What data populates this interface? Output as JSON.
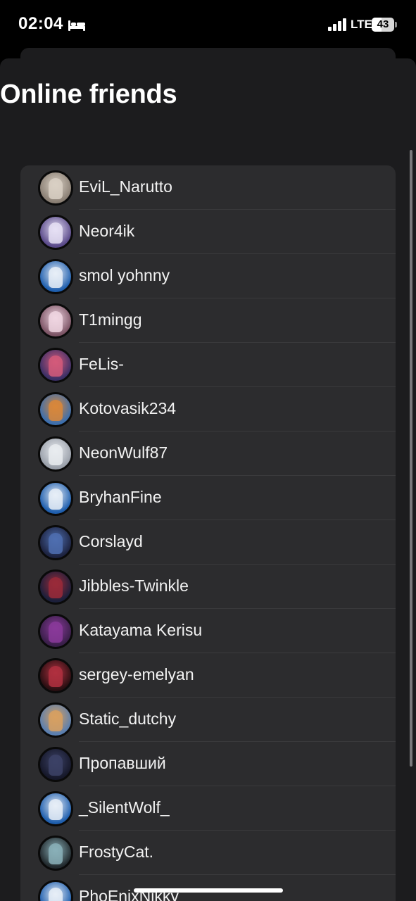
{
  "status_bar": {
    "time": "02:04",
    "network": "LTE",
    "battery_level": "43",
    "icons": [
      "bed-icon",
      "signal-icon",
      "battery-icon"
    ]
  },
  "page": {
    "title": "Online friends"
  },
  "friends": [
    {
      "name": "EviL_Narutto",
      "avatar_color": "#8a7f74",
      "figure_color": "#d9d0c4"
    },
    {
      "name": "Neor4ik",
      "avatar_color": "#5a4a8a",
      "figure_color": "#e6e0f5"
    },
    {
      "name": "smol yohnny",
      "avatar_color": "#1f5fae",
      "figure_color": "#e8eef7"
    },
    {
      "name": "T1mingg",
      "avatar_color": "#7d5566",
      "figure_color": "#f0d6e2"
    },
    {
      "name": "FeLis-",
      "avatar_color": "#3b2f66",
      "figure_color": "#d45a7a"
    },
    {
      "name": "Kotovasik234",
      "avatar_color": "#3c6fae",
      "figure_color": "#d9873a"
    },
    {
      "name": "NeonWulf87",
      "avatar_color": "#9aa0aa",
      "figure_color": "#e9ecf0"
    },
    {
      "name": "BryhanFine",
      "avatar_color": "#1f5fae",
      "figure_color": "#e8eef7"
    },
    {
      "name": "Corslayd",
      "avatar_color": "#1d2340",
      "figure_color": "#4f6fb0"
    },
    {
      "name": "Jibbles-Twinkle",
      "avatar_color": "#1b1f3a",
      "figure_color": "#9a2a3a"
    },
    {
      "name": "Katayama Kerisu",
      "avatar_color": "#3a1f4a",
      "figure_color": "#8a3a9a"
    },
    {
      "name": "sergey-emelyan",
      "avatar_color": "#2a0f12",
      "figure_color": "#b03040"
    },
    {
      "name": "Static_dutchy",
      "avatar_color": "#5a7fb0",
      "figure_color": "#d8a060"
    },
    {
      "name": "Пропавший",
      "avatar_color": "#16182a",
      "figure_color": "#3c4266"
    },
    {
      "name": "_SilentWolf_",
      "avatar_color": "#1f5fae",
      "figure_color": "#e8eef7"
    },
    {
      "name": "FrostyCat.",
      "avatar_color": "#222a2e",
      "figure_color": "#8ab0b8"
    },
    {
      "name": "PhoEnixNikky",
      "avatar_color": "#1f5fae",
      "figure_color": "#e8eef7"
    }
  ]
}
